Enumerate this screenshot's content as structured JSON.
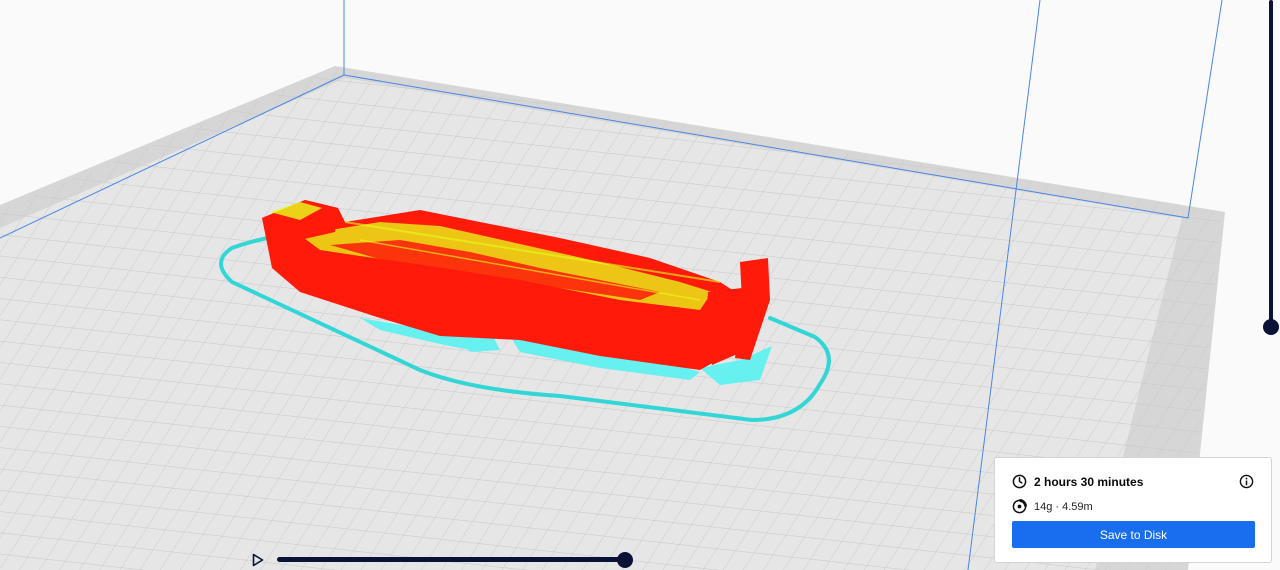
{
  "print_info": {
    "print_time": "2 hours 30 minutes",
    "material_usage": "14g · 4.59m",
    "save_label": "Save to Disk"
  },
  "icons": {
    "time": "clock-icon",
    "material": "spool-icon",
    "info": "info-icon",
    "play": "play-icon"
  },
  "colors": {
    "build_plate": "#dcdcdc",
    "wall": "#ff1a0a",
    "infill": "#e6ff1a",
    "support": "#66f0f0",
    "skirt": "#33d6d6",
    "slider": "#0b1238",
    "primary_button": "#196ef0"
  }
}
